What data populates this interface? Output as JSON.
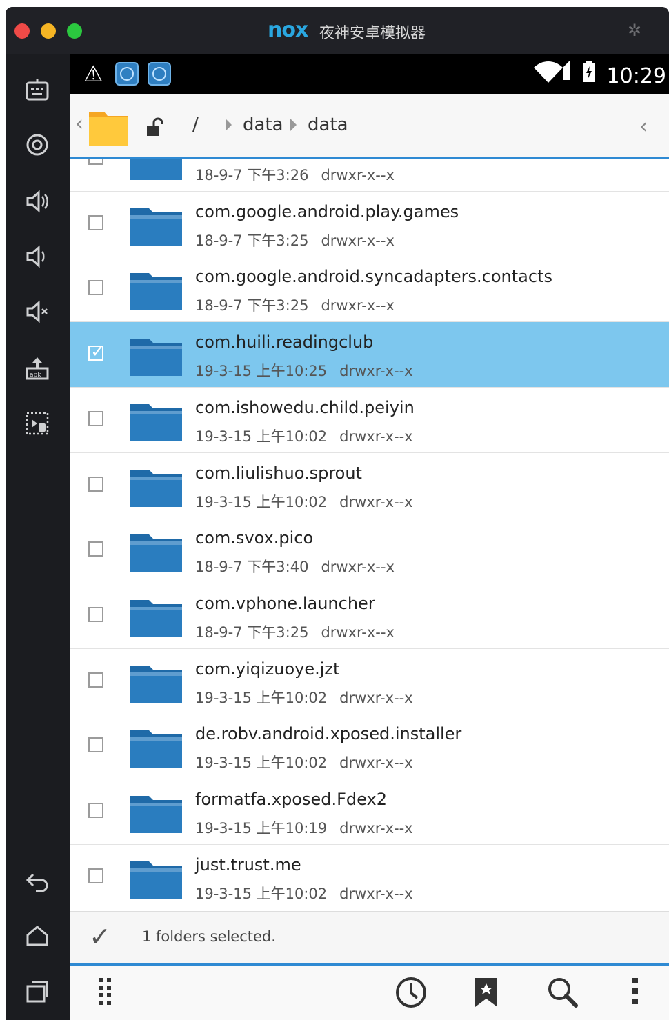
{
  "window": {
    "logo": "nox",
    "title": "夜神安卓模拟器"
  },
  "statusbar": {
    "time": "10:29"
  },
  "path": {
    "root": "/",
    "crumbs": [
      "data",
      "data"
    ]
  },
  "files": [
    {
      "name": "",
      "date": "18-9-7 下午3:26",
      "perm": "drwxr-x--x",
      "selected": false
    },
    {
      "name": "com.google.android.play.games",
      "date": "18-9-7 下午3:25",
      "perm": "drwxr-x--x",
      "selected": false
    },
    {
      "name": "com.google.android.syncadapters.contacts",
      "date": "18-9-7 下午3:25",
      "perm": "drwxr-x--x",
      "selected": false
    },
    {
      "name": "com.huili.readingclub",
      "date": "19-3-15 上午10:25",
      "perm": "drwxr-x--x",
      "selected": true
    },
    {
      "name": "com.ishowedu.child.peiyin",
      "date": "19-3-15 上午10:02",
      "perm": "drwxr-x--x",
      "selected": false
    },
    {
      "name": "com.liulishuo.sprout",
      "date": "19-3-15 上午10:02",
      "perm": "drwxr-x--x",
      "selected": false
    },
    {
      "name": "com.svox.pico",
      "date": "18-9-7 下午3:40",
      "perm": "drwxr-x--x",
      "selected": false
    },
    {
      "name": "com.vphone.launcher",
      "date": "18-9-7 下午3:25",
      "perm": "drwxr-x--x",
      "selected": false
    },
    {
      "name": "com.yiqizuoye.jzt",
      "date": "19-3-15 上午10:02",
      "perm": "drwxr-x--x",
      "selected": false
    },
    {
      "name": "de.robv.android.xposed.installer",
      "date": "19-3-15 上午10:02",
      "perm": "drwxr-x--x",
      "selected": false
    },
    {
      "name": "formatfa.xposed.Fdex2",
      "date": "19-3-15 上午10:19",
      "perm": "drwxr-x--x",
      "selected": false
    },
    {
      "name": "just.trust.me",
      "date": "19-3-15 上午10:02",
      "perm": "drwxr-x--x",
      "selected": false
    }
  ],
  "selection": {
    "text": "1 folders selected."
  },
  "colors": {
    "accent": "#2f8ad3",
    "selected_row": "#7dc7ee",
    "folder": "#2a7dbf"
  }
}
